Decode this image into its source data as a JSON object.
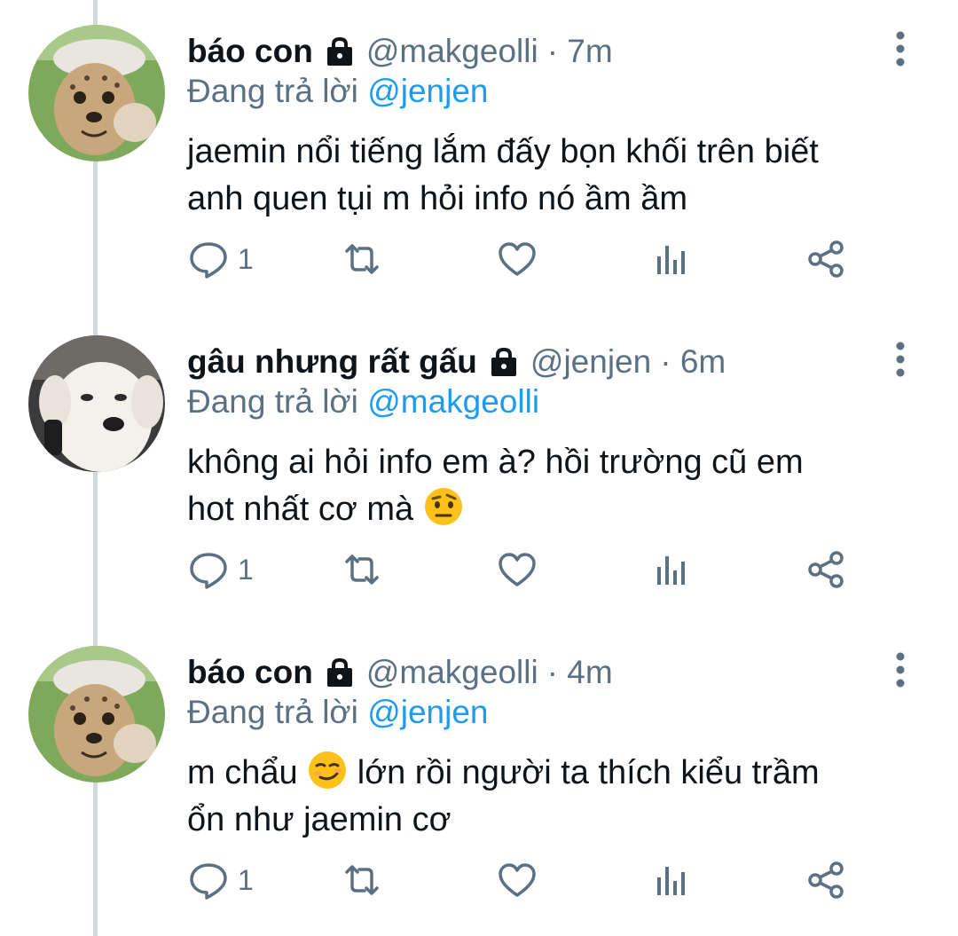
{
  "tweets": [
    {
      "name": "báo con",
      "handle": "@makgeolli",
      "time": "· 7m",
      "replying_prefix": "Đang trả lời",
      "replying_to": "@jenjen",
      "lines": [
        "jaemin nổi tiếng lắm đấy bọn khối trên biết",
        "anh quen tụi m hỏi info nó ầm ầm"
      ],
      "reply_count": "1",
      "avatar": "cheetah-cub-avatar"
    },
    {
      "name": "gâu nhưng rất gấu",
      "handle": "@jenjen",
      "time": "· 6m",
      "replying_prefix": "Đang trả lời",
      "replying_to": "@makgeolli",
      "line1": "không ai hỏi info em à? hồi trường cũ em",
      "line2": "hot nhất cơ mà",
      "emoji": "raised-eyebrow-emoji",
      "reply_count": "1",
      "avatar": "white-dog-avatar"
    },
    {
      "name": "báo con",
      "handle": "@makgeolli",
      "time": "· 4m",
      "replying_prefix": "Đang trả lời",
      "replying_to": "@jenjen",
      "line1_before": "m chẩu",
      "line1_after": "lớn rồi người ta thích kiểu trầm",
      "line2": "ổn như jaemin cơ",
      "emoji": "smirk-emoji",
      "reply_count": "1",
      "avatar": "cheetah-cub-avatar"
    }
  ],
  "colors": {
    "text": "#0f1419",
    "secondary": "#5b7083",
    "link": "#1d9bf0",
    "thread_line": "#cfd9de"
  },
  "icons": [
    "protected-lock-icon",
    "more-options-icon",
    "reply-icon",
    "retweet-icon",
    "like-icon",
    "analytics-icon",
    "share-icon"
  ]
}
